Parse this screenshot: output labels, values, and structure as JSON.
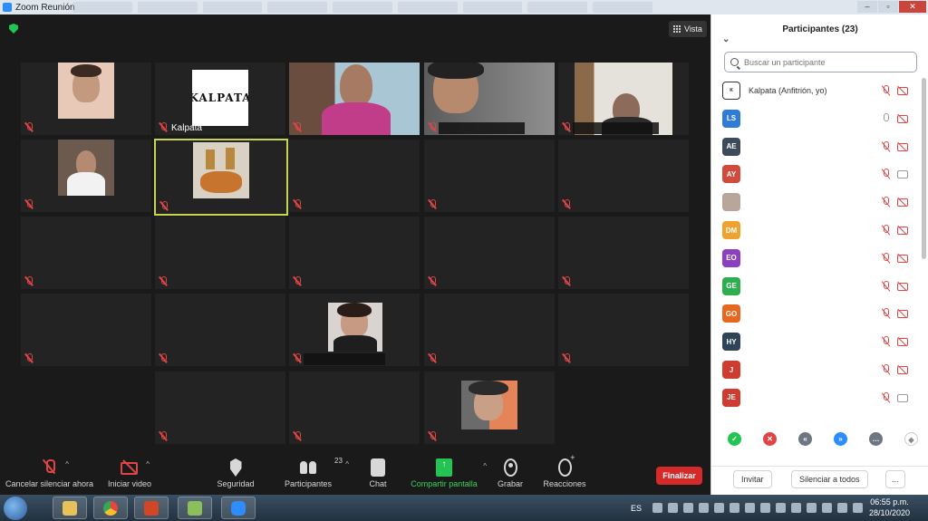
{
  "window": {
    "title": "Zoom Reunión"
  },
  "meeting": {
    "view_label": "Vista",
    "host_tile_name": "Kalpata",
    "logo_text": "KALPATA"
  },
  "toolbar": {
    "mute_label": "Cancelar silenciar ahora",
    "video_label": "Iniciar video",
    "security_label": "Seguridad",
    "participants_label": "Participantes",
    "participants_count": "23",
    "chat_label": "Chat",
    "share_label": "Compartir pantalla",
    "record_label": "Grabar",
    "reactions_label": "Reacciones",
    "end_label": "Finalizar"
  },
  "panel": {
    "title": "Participantes (23)",
    "search_placeholder": "Buscar un participante",
    "participants": [
      {
        "initials": "",
        "name": "Kalpata (Anfitrión, yo)",
        "color": "#ffffff",
        "mic": "off",
        "cam": "off"
      },
      {
        "initials": "LS",
        "name": "",
        "color": "#2f7bd6",
        "mic": "on",
        "cam": "off"
      },
      {
        "initials": "AE",
        "name": "",
        "color": "#3d4a5c",
        "mic": "off",
        "cam": "off"
      },
      {
        "initials": "AY",
        "name": "",
        "color": "#d14b3c",
        "mic": "off",
        "cam": "on"
      },
      {
        "initials": "",
        "name": "",
        "color": "#b9a69a",
        "mic": "off",
        "cam": "off"
      },
      {
        "initials": "DM",
        "name": "",
        "color": "#f0a22e",
        "mic": "off",
        "cam": "off"
      },
      {
        "initials": "EO",
        "name": "",
        "color": "#8d3fc2",
        "mic": "off",
        "cam": "off"
      },
      {
        "initials": "GE",
        "name": "",
        "color": "#2fae4f",
        "mic": "off",
        "cam": "off"
      },
      {
        "initials": "GO",
        "name": "",
        "color": "#e8671f",
        "mic": "off",
        "cam": "off"
      },
      {
        "initials": "HY",
        "name": "",
        "color": "#2f4457",
        "mic": "off",
        "cam": "off"
      },
      {
        "initials": "J",
        "name": "",
        "color": "#cf3b2e",
        "mic": "off",
        "cam": "off"
      },
      {
        "initials": "JE",
        "name": "",
        "color": "#cf3b2e",
        "mic": "off",
        "cam": "on"
      }
    ],
    "invite_label": "Invitar",
    "mute_all_label": "Silenciar a todos",
    "more_label": "..."
  },
  "taskbar": {
    "language": "ES",
    "time": "06:55 p.m.",
    "date": "28/10/2020"
  },
  "colors": {
    "accent_green": "#23c552",
    "end_red": "#d42a2a",
    "active_border": "#c6d54b"
  }
}
